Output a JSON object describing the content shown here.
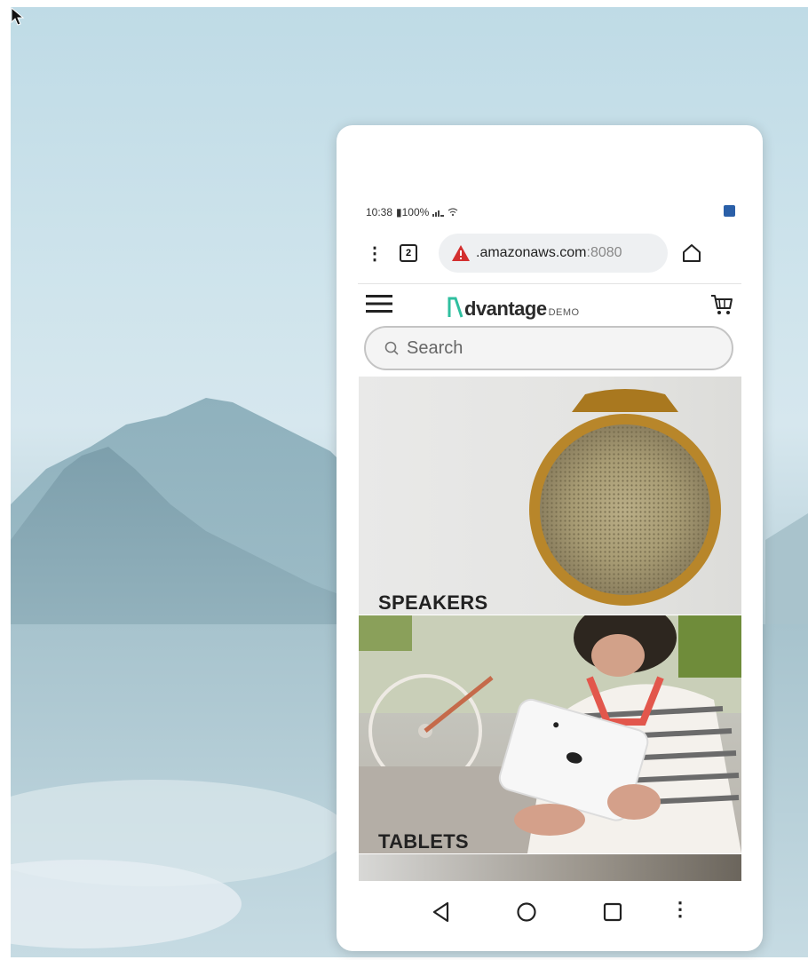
{
  "status_bar": {
    "time": "10:38",
    "battery": "▮100%"
  },
  "browser": {
    "tab_count": "2",
    "url_host": ".amazonaws.com",
    "url_port": ":8080"
  },
  "site": {
    "logo_text": "dvantage",
    "logo_sub": "DEMO",
    "search_placeholder": "Search"
  },
  "categories": [
    {
      "label": "SPEAKERS"
    },
    {
      "label": "TABLETS"
    }
  ],
  "colors": {
    "logo_accent": "#2fbf9f",
    "warning": "#d32f2f",
    "status_corner": "#2a5fa8"
  },
  "icons": {
    "menu": "hamburger-icon",
    "cart": "cart-icon",
    "search": "search-icon",
    "home": "home-icon",
    "back": "back-triangle-icon"
  }
}
